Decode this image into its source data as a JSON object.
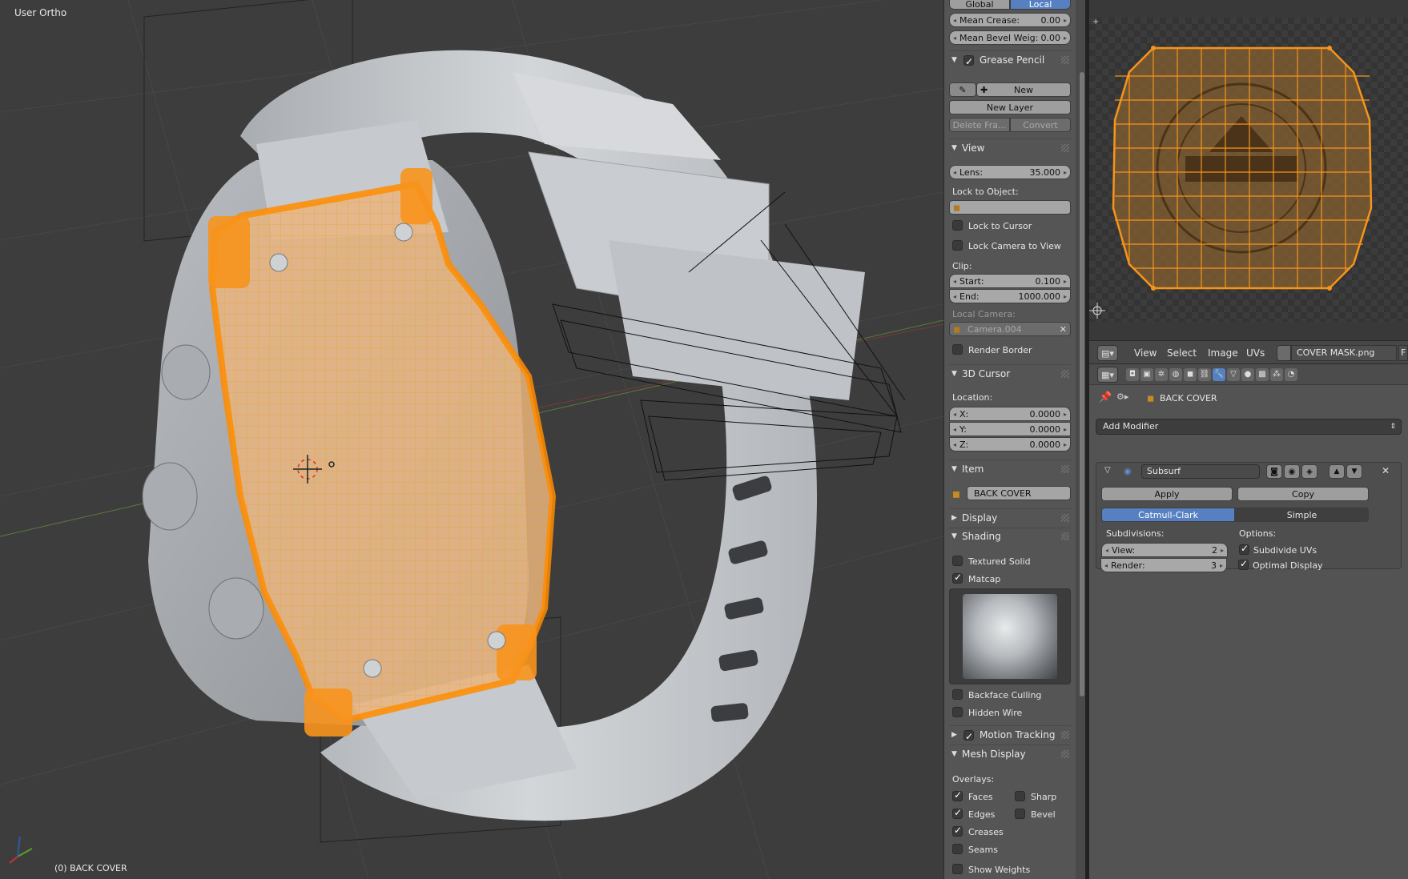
{
  "viewport": {
    "view_label": "User Ortho",
    "object_label": "(0) BACK COVER"
  },
  "npanel": {
    "transform_tabs": [
      "Global",
      "Local"
    ],
    "mean_crease": {
      "label": "Mean Crease:",
      "value": "0.00"
    },
    "mean_bevel": {
      "label": "Mean Bevel Weig:",
      "value": "0.00"
    },
    "grease_pencil": {
      "title": "Grease Pencil",
      "new_label": "New",
      "new_layer_label": "New Layer",
      "delete_frame_label": "Delete Fra...",
      "convert_label": "Convert"
    },
    "view": {
      "title": "View",
      "lens": {
        "label": "Lens:",
        "value": "35.000"
      },
      "lock_to_object": "Lock to Object:",
      "lock_to_cursor": "Lock to Cursor",
      "lock_camera": "Lock Camera to View",
      "clip": "Clip:",
      "clip_start": {
        "label": "Start:",
        "value": "0.100"
      },
      "clip_end": {
        "label": "End:",
        "value": "1000.000"
      },
      "local_camera": "Local Camera:",
      "camera_name": "Camera.004",
      "render_border": "Render Border"
    },
    "cursor": {
      "title": "3D Cursor",
      "location": "Location:",
      "x": {
        "label": "X:",
        "value": "0.0000"
      },
      "y": {
        "label": "Y:",
        "value": "0.0000"
      },
      "z": {
        "label": "Z:",
        "value": "0.0000"
      }
    },
    "item": {
      "title": "Item",
      "name": "BACK COVER"
    },
    "display": {
      "title": "Display"
    },
    "shading": {
      "title": "Shading",
      "textured_solid": "Textured Solid",
      "matcap": "Matcap",
      "backface_culling": "Backface Culling",
      "hidden_wire": "Hidden Wire"
    },
    "motion_tracking": {
      "title": "Motion Tracking"
    },
    "mesh_display": {
      "title": "Mesh Display",
      "overlays": "Overlays:",
      "faces": "Faces",
      "sharp": "Sharp",
      "edges": "Edges",
      "bevel": "Bevel",
      "creases": "Creases",
      "seams": "Seams",
      "show_weights": "Show Weights"
    }
  },
  "image_editor": {
    "menus": [
      "View",
      "Select",
      "Image",
      "UVs"
    ],
    "image_name": "COVER MASK.png",
    "extra": "F"
  },
  "properties": {
    "object_name": "BACK COVER",
    "add_modifier": "Add Modifier",
    "modifier": {
      "name": "Subsurf",
      "apply": "Apply",
      "copy": "Copy",
      "mode_catmull": "Catmull-Clark",
      "mode_simple": "Simple",
      "subdivisions": "Subdivisions:",
      "view": {
        "label": "View:",
        "value": "2"
      },
      "render": {
        "label": "Render:",
        "value": "3"
      },
      "options": "Options:",
      "subdivide_uvs": "Subdivide UVs",
      "optimal_display": "Optimal Display"
    }
  },
  "colors": {
    "selection_orange": "#f7941d",
    "active_blue": "#5680c2",
    "model_gray": "#c9ccd0",
    "viewport_bg": "#3d3d3d"
  }
}
